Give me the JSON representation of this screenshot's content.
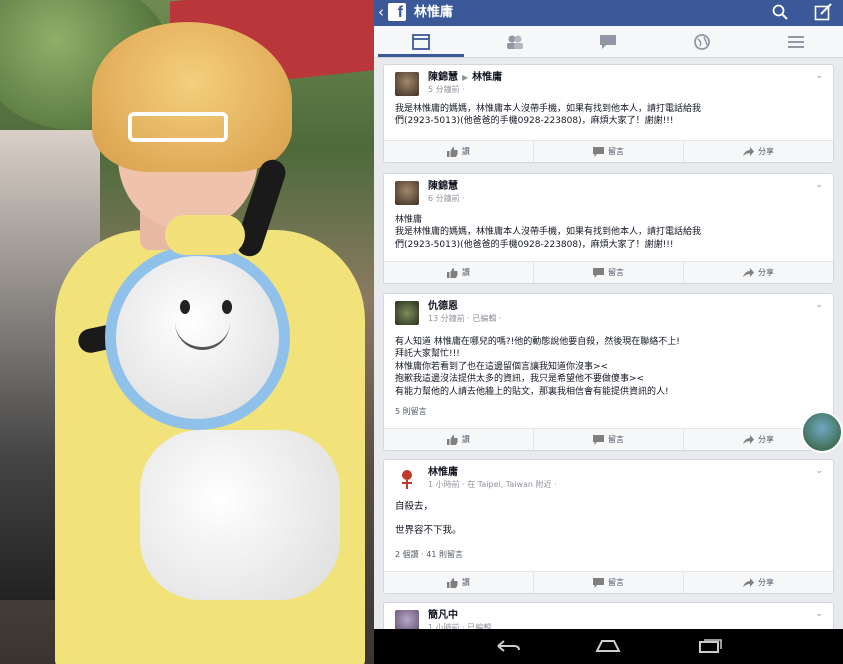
{
  "topbar": {
    "title": "林惟庸"
  },
  "nav": {
    "tabs": [
      "timeline",
      "friends",
      "messages",
      "globe",
      "menu"
    ]
  },
  "posts": [
    {
      "author": "陳錦慧",
      "target": "林惟庸",
      "meta": "5 分鐘前 ·",
      "lines": [
        "我是林惟庸的媽媽，林惟庸本人沒帶手機，如果有找到他本人，請打電話給我",
        "們(2923-5013)(他爸爸的手機0928-223808)，麻煩大家了！謝謝!!!"
      ]
    },
    {
      "author": "陳錦慧",
      "meta": "6 分鐘前 ·",
      "lines": [
        "林惟庸",
        "我是林惟庸的媽媽，林惟庸本人沒帶手機，如果有找到他本人，請打電話給我",
        "們(2923-5013)(他爸爸的手機0928-223808)，麻煩大家了！謝謝!!!"
      ]
    },
    {
      "author": "仇德恩",
      "meta": "13 分鐘前 · 已編輯 ·",
      "lines": [
        "有人知道 林惟庸在哪兒的嗎?!他的動態說他要自殺，然後現在聯絡不上!",
        "拜託大家幫忙!!!",
        "林惟庸你若看到了也在這邊留個言讓我知道你沒事><",
        "抱歉我這邊沒法提供太多的資訊，我只是希望他不要做傻事><",
        "有能力幫他的人請去他牆上的貼文，那裏我相信會有能提供資訊的人!"
      ],
      "stats": "5 則留言"
    },
    {
      "author": "林惟庸",
      "meta": "1 小時前 · 在 Taipei, Taiwan 附近 ·",
      "lines": [
        "自殺去，",
        "",
        "世界容不下我。"
      ],
      "stats": "2 個讚 · 41 則留言"
    },
    {
      "author": "簡凡中",
      "meta": "1 小時前 · 已編輯",
      "lines": []
    }
  ],
  "actions": {
    "like": "讚",
    "comment": "留言",
    "share": "分享"
  },
  "colors": {
    "fb_blue": "#3b5998",
    "feed_bg": "#e9eaed"
  }
}
